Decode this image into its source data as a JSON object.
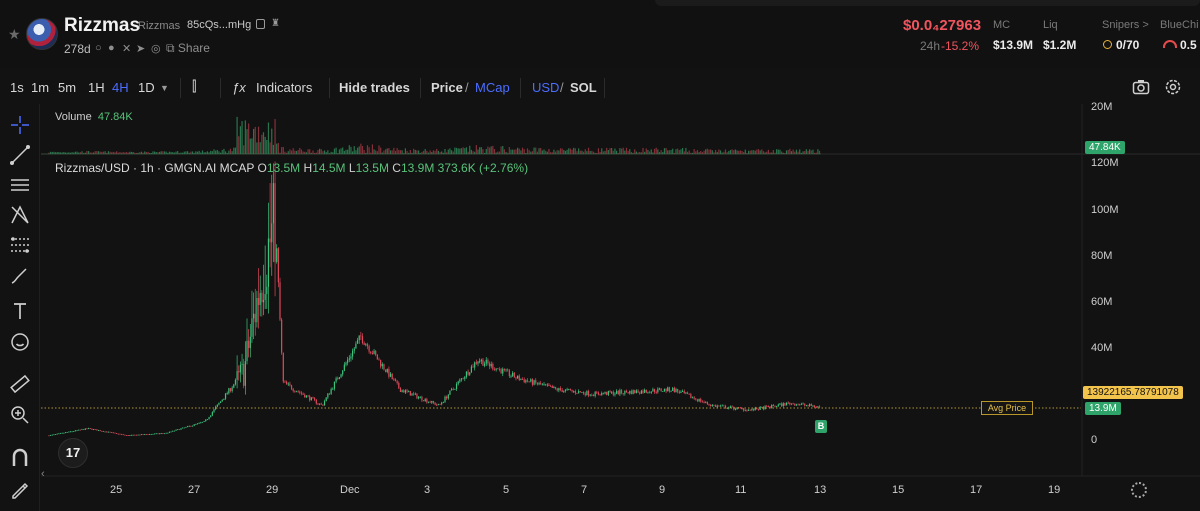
{
  "header": {
    "token_name": "Rizzmas",
    "token_sub": "Rizzmas",
    "address": "85cQs...mHg",
    "age": "278d",
    "share_label": "Share",
    "price": "$0.0₄27963",
    "change_label": "24h",
    "change": "-15.2%",
    "stats": [
      {
        "label": "MC",
        "value": "$13.9M"
      },
      {
        "label": "Liq",
        "value": "$1.2M"
      },
      {
        "label": "Snipers >",
        "value": "0/70"
      },
      {
        "label": "BlueChi",
        "value": "0.5"
      }
    ]
  },
  "toolbar": {
    "intervals": [
      "1s",
      "1m",
      "5m",
      "1H",
      "4H",
      "1D"
    ],
    "active_interval": "4H",
    "indicators_label": "Indicators",
    "hide_trades_label": "Hide trades",
    "price_label": "Price",
    "mcap_label": "MCap",
    "usd_label": "USD",
    "sol_label": "SOL"
  },
  "legend": {
    "symbol": "Rizzmas/USD · 1h · GMGN.AI MCAP",
    "o_label": "O",
    "o": "13.5M",
    "h_label": "H",
    "h": "14.5M",
    "l_label": "L",
    "l": "13.5M",
    "c_label": "C",
    "c": "13.9M",
    "change": "373.6K (+2.76%)"
  },
  "volume": {
    "label": "Volume",
    "value": "47.84K",
    "axis_label": "20M",
    "tag": "47.84K"
  },
  "avg_price": {
    "label": "Avg Price",
    "value": "13922165.78791078"
  },
  "last_tag": "13.9M",
  "buy_marker": "B",
  "tv_logo": "17",
  "colors": {
    "up": "#3cc47c",
    "down": "#e0485a",
    "accent": "#4c6dff",
    "avg": "#e6c14b"
  },
  "chart_data": {
    "type": "candlestick",
    "y_axis": [
      "120M",
      "100M",
      "80M",
      "60M",
      "40M",
      "20M",
      "0"
    ],
    "x_axis": [
      "25",
      "27",
      "29",
      "Dec",
      "3",
      "5",
      "7",
      "9",
      "11",
      "13",
      "15",
      "17",
      "19"
    ],
    "ylim": [
      0,
      120000000
    ],
    "mcap_path_M": [
      {
        "x": "Nov 23",
        "v": 2
      },
      {
        "x": "Nov 24",
        "v": 5
      },
      {
        "x": "Nov 25",
        "v": 2
      },
      {
        "x": "Nov 26",
        "v": 3
      },
      {
        "x": "Nov 27",
        "v": 8
      },
      {
        "x": "Nov 28",
        "v": 30
      },
      {
        "x": "Nov 28.5",
        "v": 75
      },
      {
        "x": "Nov 28.8",
        "v": 95
      },
      {
        "x": "Nov 29",
        "v": 25
      },
      {
        "x": "Nov 30",
        "v": 15
      },
      {
        "x": "Dec 1",
        "v": 45
      },
      {
        "x": "Dec 2",
        "v": 22
      },
      {
        "x": "Dec 3",
        "v": 15
      },
      {
        "x": "Dec 4",
        "v": 35
      },
      {
        "x": "Dec 5",
        "v": 27
      },
      {
        "x": "Dec 6",
        "v": 22
      },
      {
        "x": "Dec 7",
        "v": 20
      },
      {
        "x": "Dec 9",
        "v": 22
      },
      {
        "x": "Dec 10",
        "v": 15
      },
      {
        "x": "Dec 11",
        "v": 13
      },
      {
        "x": "Dec 12",
        "v": 16
      },
      {
        "x": "Dec 13",
        "v": 13.9
      }
    ]
  }
}
